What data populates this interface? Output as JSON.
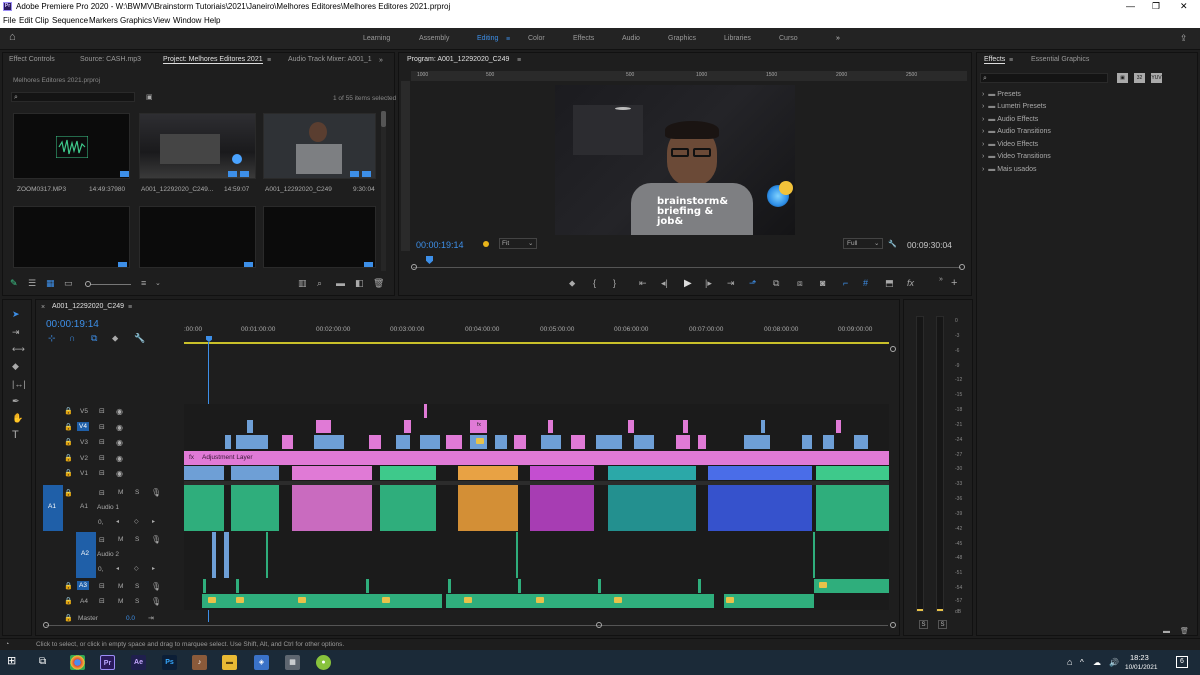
{
  "titlebar": {
    "title": "Adobe Premiere Pro 2020 - W:\\BWMV\\Brainstorm Tutoriais\\2021\\Janeiro\\Melhores Editores\\Melhores Editores 2021.prproj",
    "app_badge": "Pr"
  },
  "menu": [
    "File",
    "Edit",
    "Clip",
    "Sequence",
    "Markers",
    "Graphics",
    "View",
    "Window",
    "Help"
  ],
  "workspaces": [
    "Learning",
    "Assembly",
    "Editing",
    "Color",
    "Effects",
    "Audio",
    "Graphics",
    "Libraries",
    "Curso"
  ],
  "workspace_overflow": "»",
  "project_panel": {
    "tabs": [
      "Effect Controls",
      "Source: CASH.mp3",
      "Project: Melhores Editores 2021",
      "Audio Track Mixer: A001_1"
    ],
    "file_name": "Melhores Editores 2021.prproj",
    "item_count": "1 of 55 items selected",
    "items": [
      {
        "name": "ZOOM0317.MP3",
        "duration": "14:49:37980"
      },
      {
        "name": "A001_12292020_C249...",
        "duration": "14:59:07"
      },
      {
        "name": "A001_12292020_C249",
        "duration": "9:30:04"
      }
    ],
    "badge": "???"
  },
  "program_monitor": {
    "tab": "Program: A001_12292020_C249",
    "timecode": "00:00:19:14",
    "fit": "Fit",
    "quality": "Full",
    "duration": "00:09:30:04",
    "ruler": [
      "1000",
      "500",
      "500",
      "1000",
      "1500",
      "2000",
      "2500"
    ],
    "shirt_text": [
      "brainstorm&",
      "briefing &",
      "job&"
    ]
  },
  "effects_panel": {
    "tabs": [
      "Effects",
      "Essential Graphics"
    ],
    "folders": [
      "Presets",
      "Lumetri Presets",
      "Audio Effects",
      "Audio Transitions",
      "Video Effects",
      "Video Transitions",
      "Mais usados"
    ],
    "view_icons": [
      "32",
      "32",
      "YUV"
    ]
  },
  "timeline": {
    "tab": "A001_12292020_C249",
    "timecode": "00:00:19:14",
    "ruler": [
      ":00:00",
      "00:01:00:00",
      "00:02:00:00",
      "00:03:00:00",
      "00:04:00:00",
      "00:05:00:00",
      "00:06:00:00",
      "00:07:00:00",
      "00:08:00:00",
      "00:09:00:00"
    ],
    "video_tracks": [
      "V5",
      "V4",
      "V3",
      "V2",
      "V1"
    ],
    "audio_tracks": [
      "A1",
      "A2",
      "A3",
      "A4"
    ],
    "audio_names": [
      "Audio 1",
      "Audio 2"
    ],
    "adjustment_layer": "Adjustment Layer",
    "master_label": "Master",
    "master_value": "0.0",
    "track_toggles": {
      "mute": "M",
      "solo": "S"
    },
    "clip_marker": "fx",
    "a1_chip": "A1",
    "volume_value": "0,"
  },
  "meter": {
    "ticks": [
      "0",
      "-3",
      "-6",
      "-9",
      "-12",
      "-15",
      "-18",
      "-21",
      "-24",
      "-27",
      "-30",
      "-33",
      "-36",
      "-39",
      "-42",
      "-45",
      "-48",
      "-51",
      "-54",
      "-57",
      "dB"
    ],
    "solo_buttons": [
      "S",
      "S"
    ]
  },
  "status_text": "Click to select, or click in empty space and drag to marquee select. Use Shift, Alt, and Ctrl for other options.",
  "taskbar": {
    "apps": [
      "Pr",
      "Ae",
      "Ps"
    ],
    "time": "18:23",
    "date": "10/01/2021",
    "notif_count": "6"
  },
  "colors": {
    "accent": "#3d8fe8",
    "clip_pink": "#e07ad6",
    "clip_blue": "#6e9fd6",
    "audio_green": "#3ec98b"
  }
}
